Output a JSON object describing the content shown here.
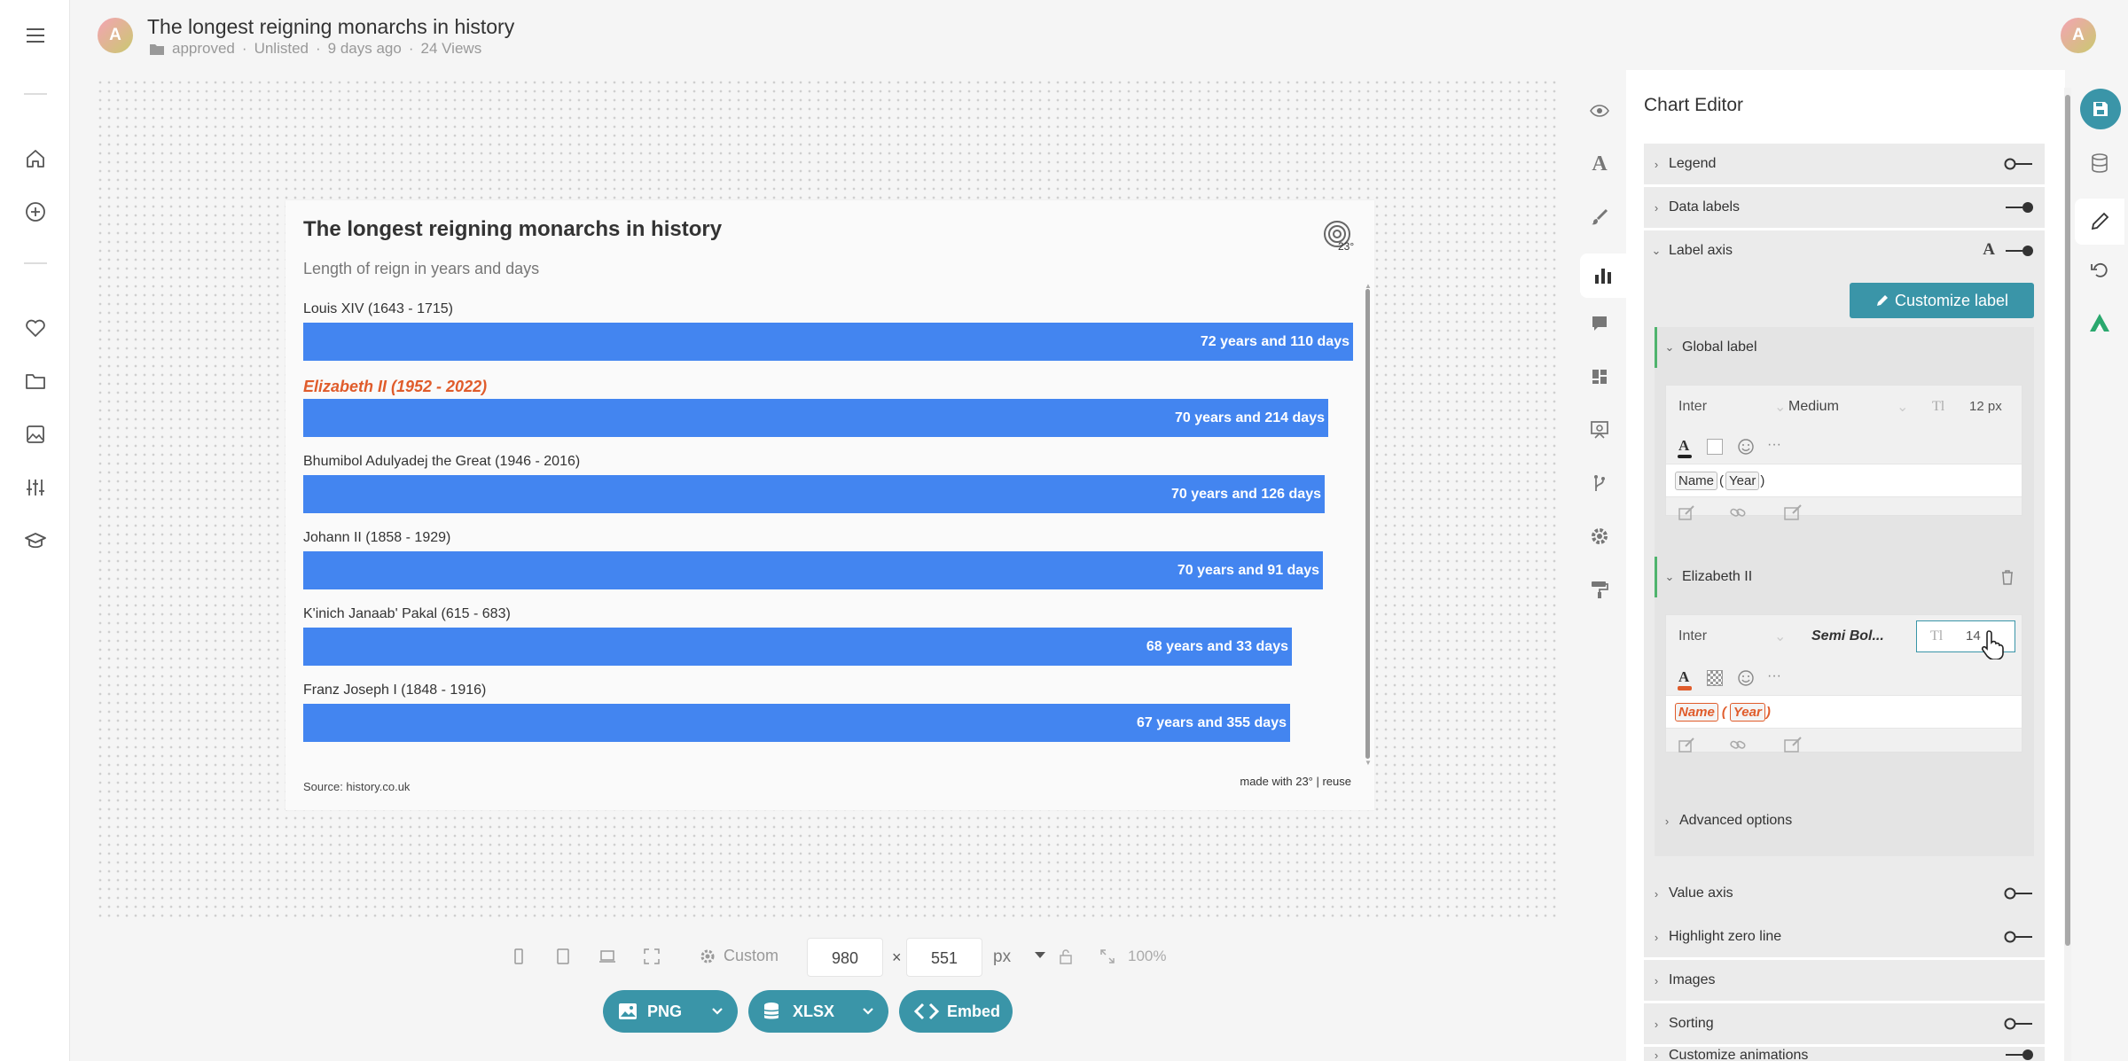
{
  "header": {
    "avatar_initial": "A",
    "title": "The longest reigning monarchs in history",
    "folder": "approved",
    "visibility": "Unlisted",
    "age": "9 days ago",
    "views": "24 Views",
    "user_initial": "A"
  },
  "nav": {
    "items": [
      "menu-icon",
      "home-icon",
      "add-icon",
      "heart-icon",
      "folder-icon",
      "image-icon",
      "sliders-icon",
      "graduation-cap-icon"
    ]
  },
  "chart_data": {
    "type": "bar",
    "orientation": "horizontal",
    "title": "The longest reigning monarchs in history",
    "subtitle": "Length of reign in years and days",
    "categories": [
      "Louis XIV (1643 - 1715)",
      "Elizabeth II (1952 - 2022)",
      "Bhumibol Adulyadej the Great (1946 - 2016)",
      "Johann II (1858 - 1929)",
      "K'inich Janaab' Pakal (615 - 683)",
      "Franz Joseph I (1848 - 1916)"
    ],
    "values": [
      72.3,
      70.59,
      70.35,
      70.25,
      68.09,
      67.97
    ],
    "value_labels": [
      "72 years and 110 days",
      "70 years and 214 days",
      "70 years and 126 days",
      "70 years and 91 days",
      "68 years and 33 days",
      "67 years and 355 days"
    ],
    "highlight_index": 1,
    "colors": {
      "bar": "#4385f0",
      "highlight_label": "#e05c2b"
    },
    "source": "Source: history.co.uk",
    "credit": "made with 23° | reuse",
    "legend": false,
    "grid": false
  },
  "toolbar": {
    "preset": "Custom",
    "width": "980",
    "times": "×",
    "height": "551",
    "unit": "px",
    "zoom": "100%",
    "export_png": "PNG",
    "export_xlsx": "XLSX",
    "embed": "Embed"
  },
  "editor": {
    "title": "Chart Editor",
    "sections": {
      "legend": "Legend",
      "data_labels": "Data labels",
      "label_axis": "Label axis",
      "global_label": "Global label",
      "elizabeth": "Elizabeth II",
      "advanced": "Advanced options",
      "value_axis": "Value axis",
      "highlight_zero": "Highlight zero line",
      "images": "Images",
      "sorting": "Sorting",
      "animations": "Customize animations"
    },
    "customize_label": "Customize label",
    "global_font": {
      "family": "Inter",
      "weight": "Medium",
      "size": "12 px",
      "token_name": "Name",
      "token_year": "Year"
    },
    "elizabeth_font": {
      "family": "Inter",
      "weight": "Semi Bol...",
      "size": "14",
      "token_name": "Name",
      "token_year": "Year"
    },
    "accent": "#3a95a8"
  }
}
